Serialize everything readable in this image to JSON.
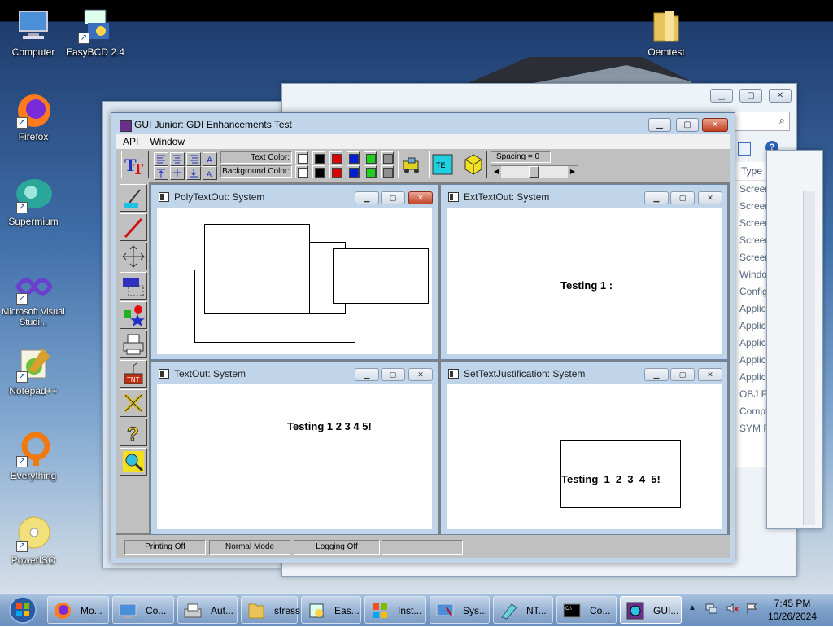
{
  "desktop": {
    "icons": [
      {
        "label": "Computer"
      },
      {
        "label": "EasyBCD 2.4"
      },
      {
        "label": "Oemtest"
      },
      {
        "label": "Firefox"
      },
      {
        "label": "Supermium"
      },
      {
        "label": "Microsoft Visual Studi..."
      },
      {
        "label": "Notepad++"
      },
      {
        "label": "Everything"
      },
      {
        "label": "PowerISO"
      }
    ]
  },
  "explorer": {
    "column_header": "Type",
    "rows": [
      "Screen s",
      "Screen s",
      "Screen s",
      "Screen s",
      "Screen s",
      "Window",
      "Configu",
      "Applicat",
      "Applicat",
      "Applicat",
      "Applicat",
      "Applicat",
      "OBJ File",
      "Compile",
      "SYM File"
    ]
  },
  "main_window": {
    "title": "GUI Junior: GDI Enhancements Test",
    "menu": [
      "API",
      "Window"
    ],
    "toolbar": {
      "text_color_label": "Text Color:",
      "background_color_label": "Background Color:",
      "spacing_label": "Spacing = 0",
      "spacing_value": 0,
      "colors": [
        "#ffffff",
        "#000000",
        "#e00000",
        "#0020d0",
        "#20d020",
        "#909090"
      ]
    },
    "children": [
      {
        "title": "PolyTextOut: System"
      },
      {
        "title": "ExtTextOut: System",
        "text": "Testing 1 :"
      },
      {
        "title": "TextOut: System",
        "text": "Testing 1 2 3 4 5!"
      },
      {
        "title": "SetTextJustification: System",
        "text": "Testing  1  2  3  4  5!"
      }
    ],
    "status": [
      "Printing Off",
      "Normal Mode",
      "Logging Off",
      ""
    ]
  },
  "taskbar": {
    "items": [
      {
        "label": "Mo..."
      },
      {
        "label": "Co..."
      },
      {
        "label": "Aut..."
      },
      {
        "label": "stress"
      },
      {
        "label": "Eas..."
      },
      {
        "label": "Inst..."
      },
      {
        "label": "Sys..."
      },
      {
        "label": "NT..."
      },
      {
        "label": "Co..."
      },
      {
        "label": "GUI..."
      }
    ],
    "time": "7:45 PM",
    "date": "10/26/2024"
  }
}
